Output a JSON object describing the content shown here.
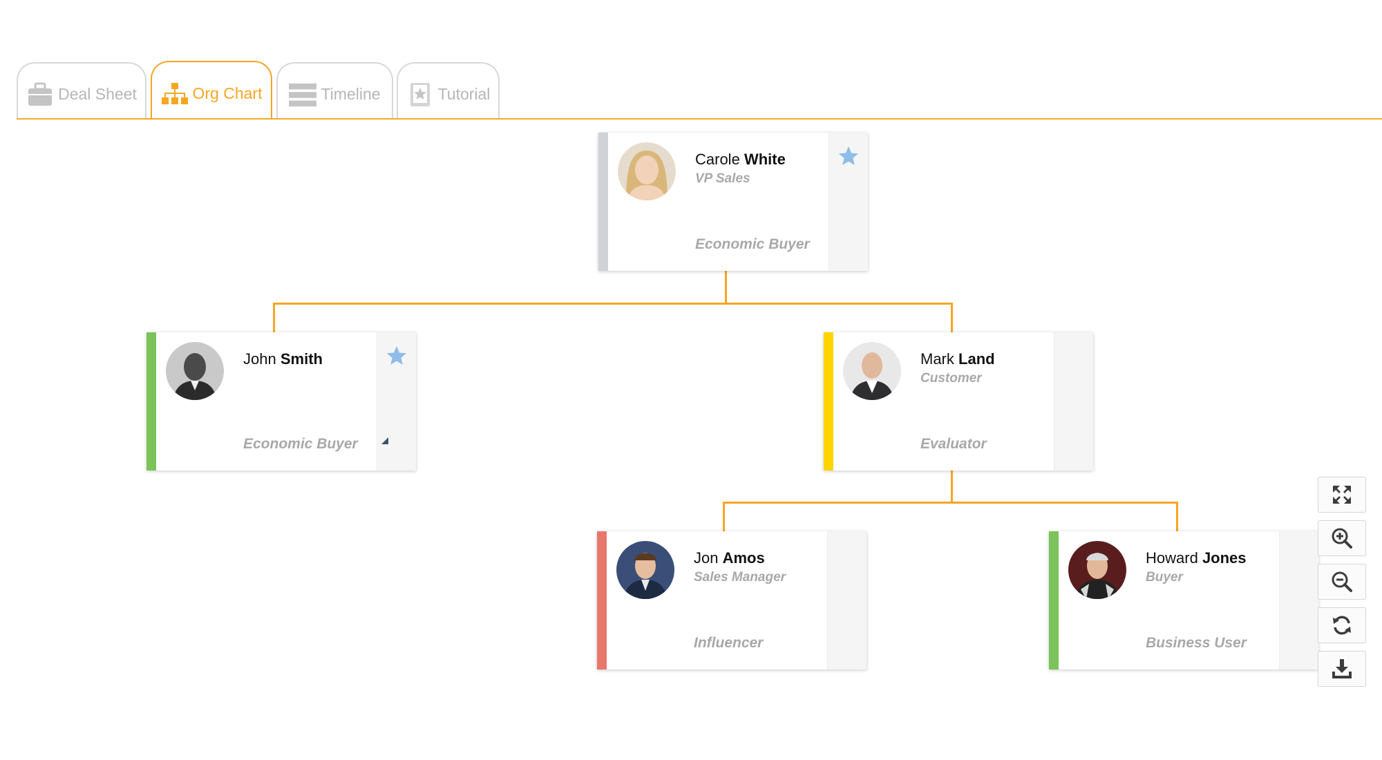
{
  "tabs": [
    {
      "id": "deal-sheet",
      "label": "Deal Sheet",
      "icon": "briefcase-icon",
      "active": false
    },
    {
      "id": "org-chart",
      "label": "Org Chart",
      "icon": "org-chart-icon",
      "active": true
    },
    {
      "id": "timeline",
      "label": "Timeline",
      "icon": "timeline-icon",
      "active": false
    },
    {
      "id": "tutorial",
      "label": "Tutorial",
      "icon": "tutorial-icon",
      "active": false
    }
  ],
  "org_chart": {
    "nodes": [
      {
        "id": "carole",
        "first": "Carole",
        "last": "White",
        "title": "VP Sales",
        "role": "Economic Buyer",
        "status_color": "#cfd2d6",
        "starred": true
      },
      {
        "id": "john",
        "first": "John",
        "last": "Smith",
        "title": "",
        "role": "Economic Buyer",
        "status_color": "#7bc35a",
        "starred": true
      },
      {
        "id": "mark",
        "first": "Mark",
        "last": "Land",
        "title": "Customer",
        "role": "Evaluator",
        "status_color": "#ffd500",
        "starred": false
      },
      {
        "id": "jon",
        "first": "Jon",
        "last": "Amos",
        "title": "Sales Manager",
        "role": "Influencer",
        "status_color": "#e8786c",
        "starred": false
      },
      {
        "id": "howard",
        "first": "Howard",
        "last": "Jones",
        "title": "Buyer",
        "role": "Business User",
        "status_color": "#7bc35a",
        "starred": false
      }
    ],
    "edges": [
      [
        "carole",
        "john"
      ],
      [
        "carole",
        "mark"
      ],
      [
        "mark",
        "jon"
      ],
      [
        "mark",
        "howard"
      ]
    ]
  },
  "toolbar": [
    {
      "id": "fit",
      "icon": "expand-icon"
    },
    {
      "id": "zoom-in",
      "icon": "zoom-in-icon"
    },
    {
      "id": "zoom-out",
      "icon": "zoom-out-icon"
    },
    {
      "id": "refresh",
      "icon": "refresh-icon"
    },
    {
      "id": "download",
      "icon": "download-icon"
    }
  ],
  "colors": {
    "accent": "#f5a623",
    "star": "#8dbde8",
    "muted_text": "#a8a8a8",
    "inactive_tab": "#b6b6b6"
  }
}
